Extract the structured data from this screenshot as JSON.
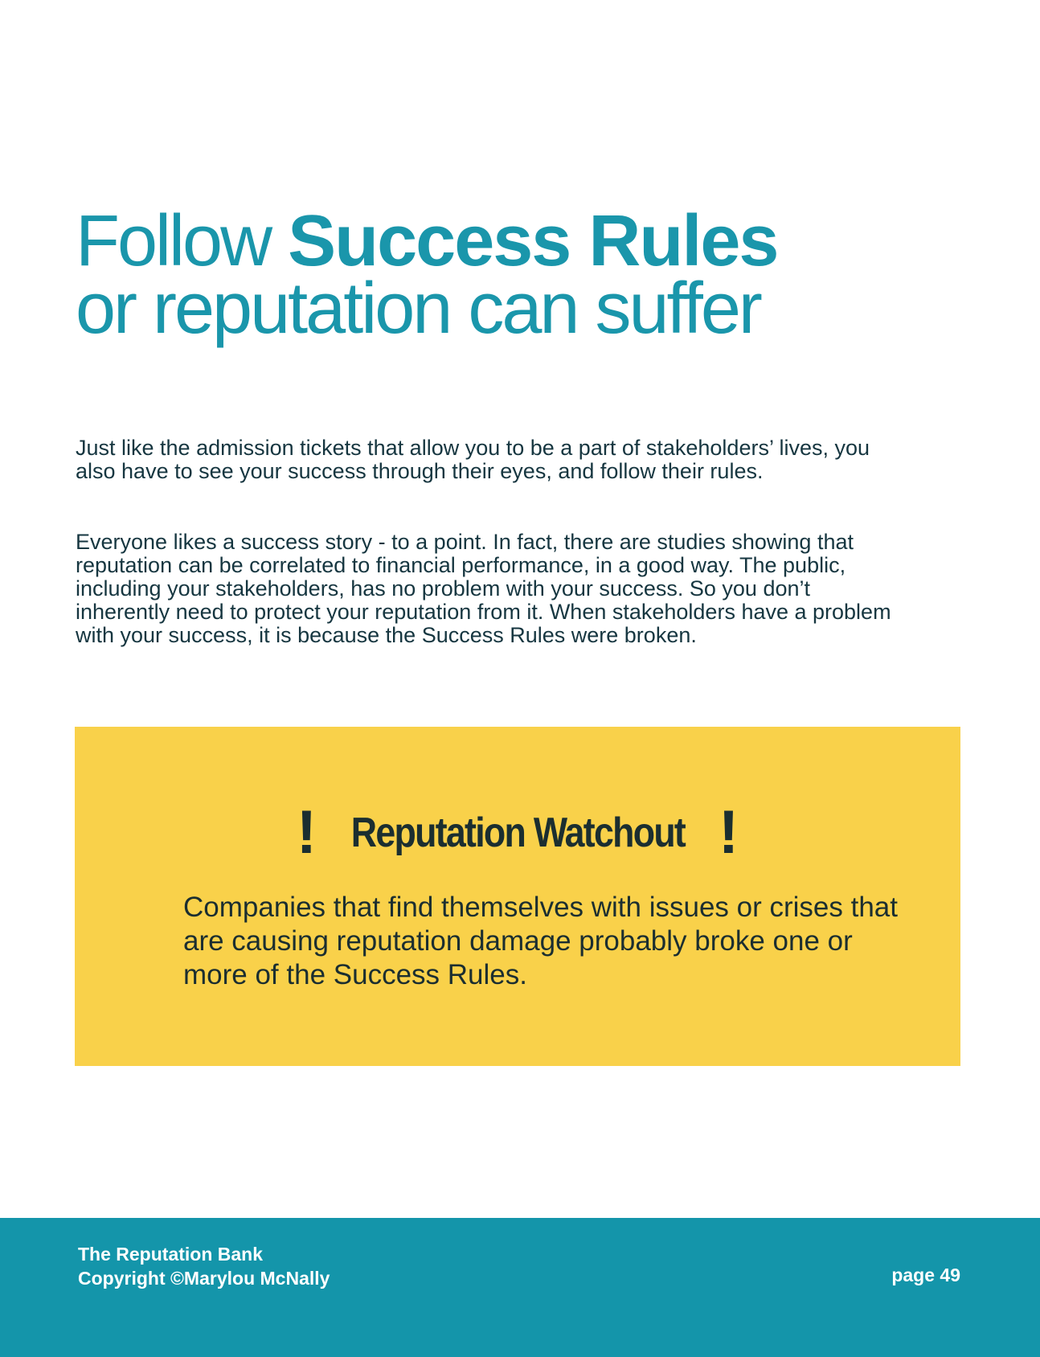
{
  "title": {
    "line1_prefix": "Follow ",
    "line1_bold": "Success Rules",
    "line2": "or reputation can suffer"
  },
  "paragraphs": [
    "Just like the admission tickets that allow you to be a part of stakeholders’ lives, you also have to see your success through their eyes, and follow their rules.",
    "Everyone likes a success story - to a point. In fact, there are studies showing that reputation can be correlated to financial performance, in a good way. The public, including your stakeholders, has no problem with your success. So you don’t inherently need to protect your reputation from it. When stakeholders have a problem with your success, it is because the Success Rules were broken."
  ],
  "watchout": {
    "icon_left": "!",
    "heading": "Reputation Watchout",
    "icon_right": "!",
    "body": "Companies that find themselves with issues or crises that are causing reputation damage probably broke one or more of the Success Rules."
  },
  "footer": {
    "line1": "The Reputation Bank",
    "line2": "Copyright ©Marylou McNally",
    "page": "page 49"
  },
  "colors": {
    "title": "#1a96ab",
    "body_text": "#163640",
    "watchout_bg": "#f9d14a",
    "footer_bg": "#1495aa"
  }
}
